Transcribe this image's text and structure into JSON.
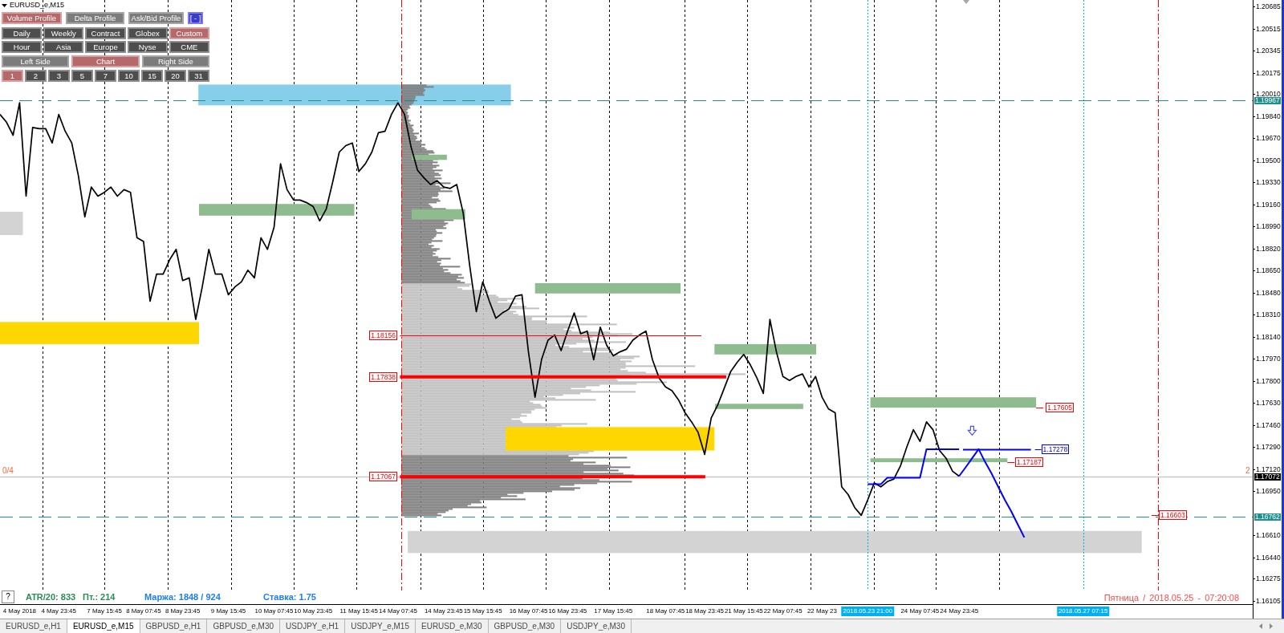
{
  "chart_header": {
    "title": "EURUSD_e,M15"
  },
  "panel": {
    "profile_buttons": [
      {
        "label": "Volume Profile",
        "selected": true
      },
      {
        "label": "Delta Profile",
        "selected": false
      },
      {
        "label": "Ask/Bid Profile",
        "selected": false
      }
    ],
    "collapse_button": "[ - ]",
    "period_buttons": [
      {
        "label": "Daily",
        "selected": false
      },
      {
        "label": "Weekly",
        "selected": false
      },
      {
        "label": "Contract",
        "selected": false
      },
      {
        "label": "Globex",
        "selected": false
      },
      {
        "label": "Custom",
        "selected": true
      },
      {
        "label": "Hour",
        "selected": false
      },
      {
        "label": "Asia",
        "selected": false
      },
      {
        "label": "Europe",
        "selected": false
      },
      {
        "label": "Nyse",
        "selected": false
      },
      {
        "label": "CME",
        "selected": false
      }
    ],
    "side_buttons": [
      {
        "label": "Left Side",
        "selected": false
      },
      {
        "label": "Chart",
        "selected": true
      },
      {
        "label": "Right Side",
        "selected": false
      }
    ],
    "count_buttons": [
      {
        "label": "1",
        "selected": true
      },
      {
        "label": "2",
        "selected": false
      },
      {
        "label": "3",
        "selected": false
      },
      {
        "label": "5",
        "selected": false
      },
      {
        "label": "7",
        "selected": false
      },
      {
        "label": "10",
        "selected": false
      },
      {
        "label": "15",
        "selected": false
      },
      {
        "label": "20",
        "selected": false
      },
      {
        "label": "31",
        "selected": false
      }
    ]
  },
  "chart": {
    "chart_data": {
      "type": "line",
      "categories": [
        null,
        null,
        null,
        "4 May 2018",
        null,
        null,
        null,
        null,
        null,
        "4 May 23:45",
        null,
        null,
        null,
        null,
        null,
        null,
        "7 May 15:45",
        null,
        null,
        null,
        null,
        null,
        "8 May 07:45",
        null,
        null,
        null,
        null,
        null,
        "8 May 23:45",
        null,
        null,
        null,
        null,
        null,
        null,
        "9 May 15:45",
        null,
        null,
        null,
        null,
        null,
        null,
        "10 May 07:45",
        null,
        null,
        null,
        null,
        null,
        "10 May 23:45",
        null,
        null,
        null,
        null,
        null,
        null,
        "11 May 15:45",
        null,
        null,
        null,
        null,
        null,
        "14 May 07:45",
        null,
        null,
        null,
        null,
        null,
        null,
        "14 May 23:45",
        null,
        null,
        null,
        null,
        null,
        "15 May 15:45",
        null,
        null,
        null,
        null,
        null,
        null,
        "16 May 07:45",
        null,
        null,
        null,
        null,
        null,
        "16 May 23:45",
        null,
        null,
        null,
        null,
        null,
        null,
        "17 May 15:45",
        null,
        null,
        null,
        null,
        null,
        null,
        null,
        "18 May 07:45",
        null,
        null,
        null,
        null,
        null,
        "18 May 23:45",
        null,
        null,
        null,
        null,
        null,
        "21 May 15:45",
        null,
        null,
        null,
        null,
        null,
        "22 May 07:45",
        null,
        null,
        null,
        null,
        null,
        "22 May 23",
        null,
        null,
        null,
        null,
        null,
        null,
        null,
        null,
        null,
        null,
        null,
        null,
        null,
        null,
        "24 May 07:45",
        null,
        null,
        null,
        null,
        null,
        "24 May 23:45",
        null,
        null,
        null,
        null,
        null,
        null,
        null,
        null,
        null,
        null,
        null,
        null,
        null,
        null,
        null,
        null,
        null,
        null,
        null,
        null,
        null,
        null,
        null,
        null,
        null,
        null,
        null,
        null,
        null,
        null,
        null,
        null,
        null,
        null,
        null,
        null,
        null,
        null,
        null,
        null,
        null,
        null,
        null,
        null
      ],
      "series": [
        {
          "color": "#000000",
          "values": [
            1.1986,
            1.198,
            1.197,
            1.1995,
            1.1923,
            1.1976,
            1.1975,
            1.1975,
            1.1964,
            1.1986,
            1.1973,
            1.1964,
            1.1939,
            1.1907,
            1.193,
            1.1923,
            1.1926,
            1.193,
            1.1923,
            1.1928,
            1.1926,
            1.1891,
            1.1888,
            1.1842,
            1.1863,
            1.1863,
            1.1874,
            1.1882,
            1.1858,
            1.186,
            1.1828,
            1.1853,
            1.1882,
            1.1863,
            1.1863,
            1.1847,
            1.1853,
            1.1857,
            1.1866,
            1.186,
            1.1891,
            1.1882,
            1.1899,
            1.1948,
            1.1928,
            1.192,
            1.192,
            1.1918,
            1.1915,
            1.1904,
            1.1913,
            1.1934,
            1.1957,
            1.1962,
            1.1964,
            1.1942,
            1.1948,
            1.1957,
            1.1972,
            1.1973,
            1.1986,
            1.1995,
            1.1986,
            1.1961,
            1.1943,
            1.1937,
            1.1932,
            1.1935,
            1.193,
            1.1929,
            1.1932,
            1.191,
            1.1869,
            1.1834,
            1.1857,
            1.1842,
            1.1829,
            1.1833,
            1.1836,
            1.1846,
            1.1847,
            1.1803,
            1.1768,
            1.1797,
            1.1812,
            1.1816,
            1.1804,
            1.1819,
            1.1833,
            1.1817,
            1.1819,
            1.1797,
            1.1822,
            1.1808,
            1.18,
            1.1803,
            1.1805,
            1.1812,
            1.1816,
            1.1819,
            1.1797,
            1.1783,
            1.1776,
            1.1773,
            1.1766,
            1.1756,
            1.1749,
            1.1741,
            1.1724,
            1.1752,
            1.1762,
            1.1775,
            1.1788,
            1.1795,
            1.1801,
            1.1793,
            1.1783,
            1.1771,
            1.1828,
            1.1803,
            1.1784,
            1.1781,
            1.1784,
            1.1786,
            1.1776,
            1.1784,
            1.1768,
            1.1759,
            1.1756,
            1.1699,
            1.1693,
            1.1683,
            1.1677,
            1.1689,
            1.1702,
            1.1699,
            1.1703,
            1.1705,
            1.1715,
            1.173,
            1.1743,
            1.1734,
            1.1749,
            1.1743,
            1.1727,
            1.1721,
            1.1711,
            1.17072,
            null,
            null,
            null,
            null,
            null,
            null,
            null,
            null,
            null,
            null,
            null,
            null,
            null,
            null,
            null,
            null,
            null,
            null,
            null,
            null,
            null,
            null,
            null,
            null,
            null,
            null,
            null,
            null,
            null,
            null,
            null,
            null,
            null,
            null,
            null,
            null,
            null,
            null,
            null,
            null,
            null,
            null,
            null,
            null
          ]
        },
        {
          "color": "#0000ff",
          "values": [
            null,
            null,
            null,
            null,
            null,
            null,
            null,
            null,
            null,
            null,
            null,
            null,
            null,
            null,
            null,
            null,
            null,
            null,
            null,
            null,
            null,
            null,
            null,
            null,
            null,
            null,
            null,
            null,
            null,
            null,
            null,
            null,
            null,
            null,
            null,
            null,
            null,
            null,
            null,
            null,
            null,
            null,
            null,
            null,
            null,
            null,
            null,
            null,
            null,
            null,
            null,
            null,
            null,
            null,
            null,
            null,
            null,
            null,
            null,
            null,
            null,
            null,
            null,
            null,
            null,
            null,
            null,
            null,
            null,
            null,
            null,
            null,
            null,
            null,
            null,
            null,
            null,
            null,
            null,
            null,
            null,
            null,
            null,
            null,
            null,
            null,
            null,
            null,
            null,
            null,
            null,
            null,
            null,
            null,
            null,
            null,
            null,
            null,
            null,
            null,
            null,
            null,
            null,
            null,
            null,
            null,
            null,
            null,
            null,
            null,
            null,
            null,
            null,
            null,
            null,
            null,
            null,
            null,
            null,
            null,
            null,
            null,
            null,
            null,
            null,
            null,
            null,
            null,
            null,
            null,
            null,
            null,
            null,
            1.1701,
            1.1701,
            1.1701,
            1.1706,
            1.1706,
            1.1706,
            1.1706,
            1.1706,
            1.1706,
            1.1728,
            1.1728,
            1.1728,
            1.1728,
            1.1728,
            1.1728,
            null,
            null,
            null,
            null,
            null,
            null,
            null,
            null,
            null,
            null,
            null,
            null,
            null,
            null,
            null,
            null,
            null,
            null,
            null,
            null,
            null,
            null,
            null,
            null,
            null,
            null,
            null,
            null,
            null,
            null,
            null,
            null,
            null,
            null,
            null,
            null,
            null,
            null,
            null,
            null,
            null,
            null,
            null,
            null
          ]
        },
        {
          "color": "#0000ff",
          "values": [
            null,
            null,
            null,
            null,
            null,
            null,
            null,
            null,
            null,
            null,
            null,
            null,
            null,
            null,
            null,
            null,
            null,
            null,
            null,
            null,
            null,
            null,
            null,
            null,
            null,
            null,
            null,
            null,
            null,
            null,
            null,
            null,
            null,
            null,
            null,
            null,
            null,
            null,
            null,
            null,
            null,
            null,
            null,
            null,
            null,
            null,
            null,
            null,
            null,
            null,
            null,
            null,
            null,
            null,
            null,
            null,
            null,
            null,
            null,
            null,
            null,
            null,
            null,
            null,
            null,
            null,
            null,
            null,
            null,
            null,
            null,
            null,
            null,
            null,
            null,
            null,
            null,
            null,
            null,
            null,
            null,
            null,
            null,
            null,
            null,
            null,
            null,
            null,
            null,
            null,
            null,
            null,
            null,
            null,
            null,
            null,
            null,
            null,
            null,
            null,
            null,
            null,
            null,
            null,
            null,
            null,
            null,
            null,
            null,
            null,
            null,
            null,
            null,
            null,
            null,
            null,
            null,
            null,
            null,
            null,
            null,
            null,
            null,
            null,
            null,
            null,
            null,
            null,
            null,
            null,
            null,
            null,
            null,
            null,
            null,
            null,
            null,
            null,
            null,
            null,
            null,
            null,
            null,
            null,
            null,
            null,
            null,
            1.17072,
            1.1714,
            1.1721,
            1.1728,
            1.1718,
            1.1709,
            1.1699,
            1.1689,
            1.168,
            1.167,
            1.166,
            null,
            null,
            null,
            null,
            null,
            null,
            null,
            null,
            null,
            null,
            null,
            null,
            null,
            null,
            null,
            null,
            null,
            null,
            null,
            null,
            null,
            null,
            null,
            null,
            null,
            null,
            null,
            null,
            null,
            null,
            null,
            null,
            null,
            null
          ]
        }
      ],
      "ylim": [
        1.16086,
        1.20742
      ],
      "yticks": [
        {
          "value": 1.20685,
          "label": "1.20685"
        },
        {
          "value": 1.20515,
          "label": "1.20515"
        },
        {
          "value": 1.20345,
          "label": "1.20345"
        },
        {
          "value": 1.20175,
          "label": "1.20175"
        },
        {
          "value": 1.2001,
          "label": "1.20010"
        },
        {
          "value": 1.1984,
          "label": "1.19840"
        },
        {
          "value": 1.1967,
          "label": "1.19670"
        },
        {
          "value": 1.195,
          "label": "1.19500"
        },
        {
          "value": 1.1933,
          "label": "1.19330"
        },
        {
          "value": 1.1916,
          "label": "1.19160"
        },
        {
          "value": 1.1899,
          "label": "1.18990"
        },
        {
          "value": 1.1882,
          "label": "1.18820"
        },
        {
          "value": 1.1865,
          "label": "1.18650"
        },
        {
          "value": 1.1848,
          "label": "1.18480"
        },
        {
          "value": 1.1831,
          "label": "1.18310"
        },
        {
          "value": 1.1814,
          "label": "1.18140"
        },
        {
          "value": 1.1797,
          "label": "1.17970"
        },
        {
          "value": 1.178,
          "label": "1.17800"
        },
        {
          "value": 1.1763,
          "label": "1.17630"
        },
        {
          "value": 1.1746,
          "label": "1.17460"
        },
        {
          "value": 1.1729,
          "label": "1.17290"
        },
        {
          "value": 1.1712,
          "label": "1.17120"
        },
        {
          "value": 1.1695,
          "label": "1.16950"
        },
        {
          "value": 1.1661,
          "label": "1.16610"
        },
        {
          "value": 1.1644,
          "label": "1.16440"
        },
        {
          "value": 1.16275,
          "label": "1.16275"
        },
        {
          "value": 1.16105,
          "label": "1.16105"
        }
      ],
      "ref_lines": [
        {
          "axis": "y",
          "value": 1.19967,
          "label": "1.19967",
          "color": "#20908f"
        },
        {
          "axis": "y",
          "value": 1.17072,
          "label": "1.17072",
          "color": "#c8c8c8"
        },
        {
          "axis": "y",
          "value": 1.16762,
          "label": "1.16762",
          "color": "#20908f"
        }
      ],
      "annotations": [
        "1.18156",
        "1.17838",
        "1.17067",
        "1.17605",
        "1.17187",
        "1.16603"
      ]
    },
    "time_markers": [
      "2018.05.23 21:00",
      "2018.05.27 07:15"
    ],
    "projection_label": "1.17278"
  },
  "overlay": {
    "left_counter": "0/4",
    "right_counter": "2",
    "help_button": "?",
    "indicators": [
      {
        "text": "ATR/20: 833",
        "color": "#2e8b57"
      },
      {
        "text": "Пт.: 214",
        "color": "#2e8b57"
      },
      {
        "text": "Маржа: 1848 / 924",
        "color": "#1e7fe8"
      },
      {
        "text": "Ставка: 1.75",
        "color": "#1e7fe8"
      }
    ],
    "server_time": "Пятница / 2018.05.25 - 07:20:08"
  },
  "tabs": [
    {
      "label": "EURUSD_e,H1",
      "selected": false
    },
    {
      "label": "EURUSD_e,M15",
      "selected": true
    },
    {
      "label": "GBPUSD_e,H1",
      "selected": false
    },
    {
      "label": "GBPUSD_e,M30",
      "selected": false
    },
    {
      "label": "USDJPY_e,H1",
      "selected": false
    },
    {
      "label": "USDJPY_e,M15",
      "selected": false
    },
    {
      "label": "EURUSD_e,M30",
      "selected": false
    },
    {
      "label": "GBPUSD_e,M30",
      "selected": false
    },
    {
      "label": "USDJPY_e,M30",
      "selected": false
    }
  ]
}
